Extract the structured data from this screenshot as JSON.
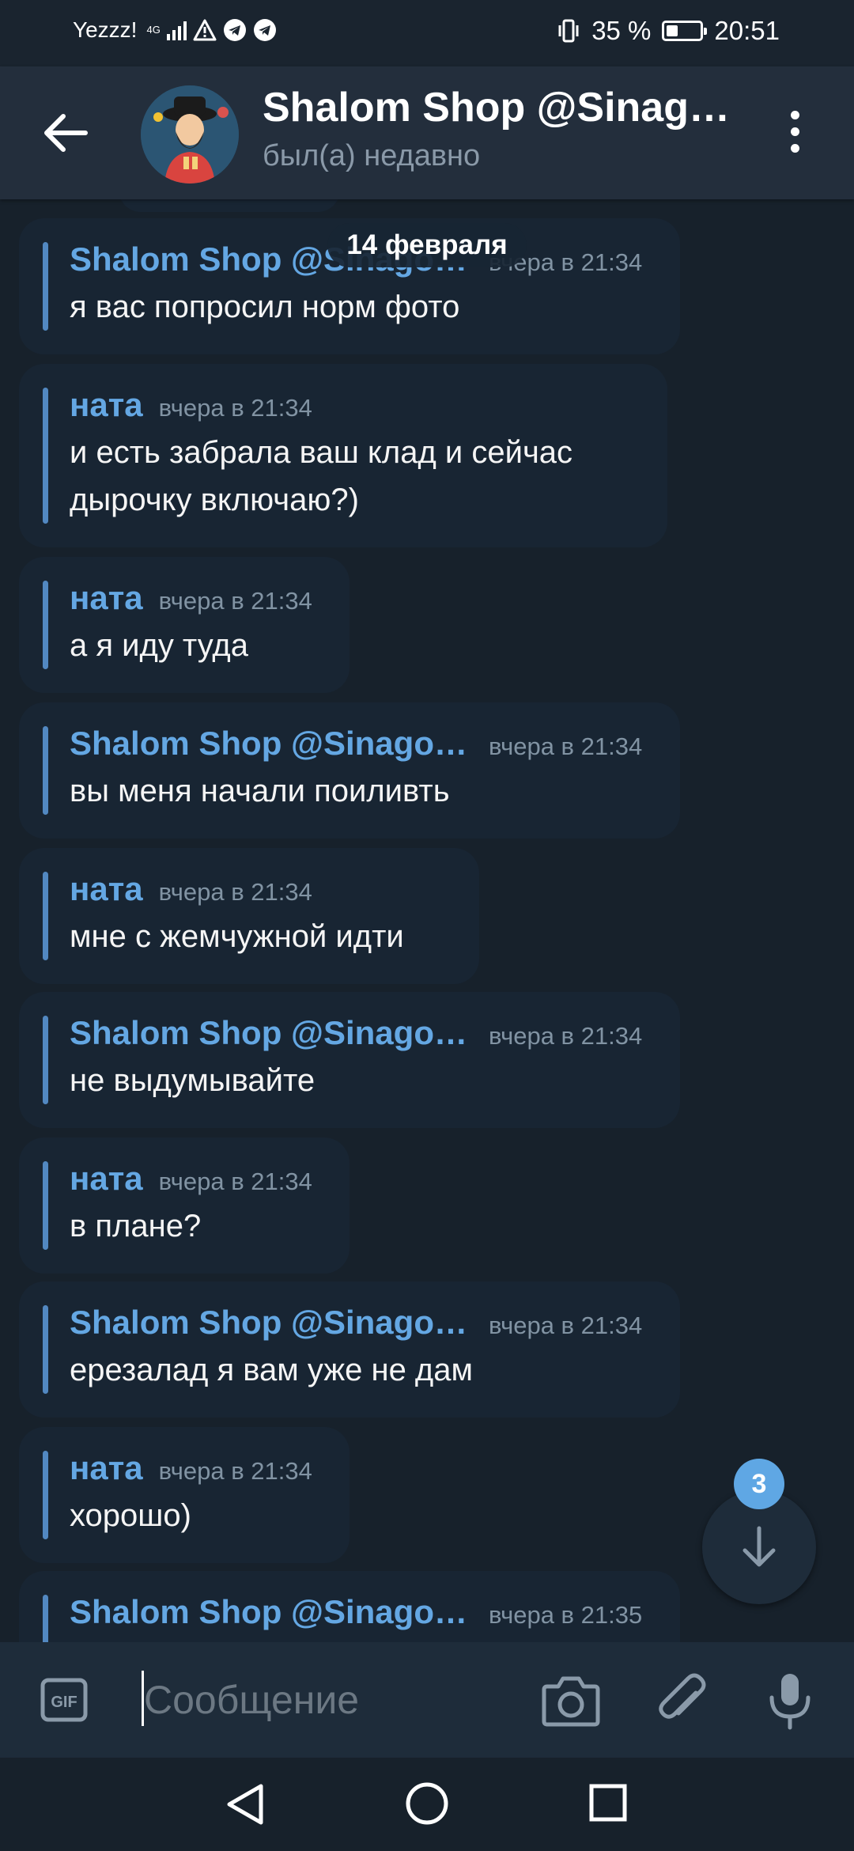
{
  "status_bar": {
    "carrier": "Yezzz!",
    "network": "4G",
    "vibrate_battery": "35 %",
    "time": "20:51",
    "icons": [
      "signal-icon",
      "warning-icon",
      "telegram-icon",
      "telegram-icon",
      "vibrate-icon",
      "battery-icon"
    ]
  },
  "header": {
    "title": "Shalom Shop @Sinago...",
    "subtitle": "был(а) недавно",
    "back_icon": "arrow-left-icon",
    "menu_icon": "more-vertical-icon"
  },
  "date_pill": "14 февраля",
  "messages": [
    {
      "sender": "Shalom Shop @Sinagog...",
      "time": "вчера в 21:34",
      "text": "я вас попросил норм фото"
    },
    {
      "sender": "ната",
      "time": "вчера в 21:34",
      "text": "и есть забрала ваш клад и сейчас дырочку включаю?)"
    },
    {
      "sender": "ната",
      "time": "вчера в 21:34",
      "text": "а я иду туда"
    },
    {
      "sender": "Shalom Shop @Sinagog...",
      "time": "вчера в 21:34",
      "text": "вы меня начали поиливть"
    },
    {
      "sender": "ната",
      "time": "вчера в 21:34",
      "text": "мне с жемчужной идти"
    },
    {
      "sender": "Shalom Shop @Sinagog...",
      "time": "вчера в 21:34",
      "text": "не выдумывайте"
    },
    {
      "sender": "ната",
      "time": "вчера в 21:34",
      "text": "в плане?"
    },
    {
      "sender": "Shalom Shop @Sinagog...",
      "time": "вчера в 21:34",
      "text": "ерезалад я вам уже не дам"
    },
    {
      "sender": "ната",
      "time": "вчера в 21:34",
      "text": "хорошо)"
    },
    {
      "sender": "Shalom Shop @Sinagog...",
      "time": "вчера в 21:35",
      "text": ""
    }
  ],
  "scroll_down": {
    "badge": "3",
    "icon": "arrow-down-icon"
  },
  "composer": {
    "placeholder": "Сообщение",
    "value": "",
    "icons": [
      "gif-icon",
      "camera-icon",
      "paperclip-icon",
      "microphone-icon"
    ]
  },
  "nav_bar": {
    "icons": [
      "nav-back-icon",
      "nav-home-icon",
      "nav-recents-icon"
    ]
  },
  "colors": {
    "background": "#17212b",
    "header": "#232e3c",
    "bubble": "#182533",
    "accent": "#64a7e3",
    "quote_bar": "#5288c1",
    "badge": "#5fa7e4"
  }
}
